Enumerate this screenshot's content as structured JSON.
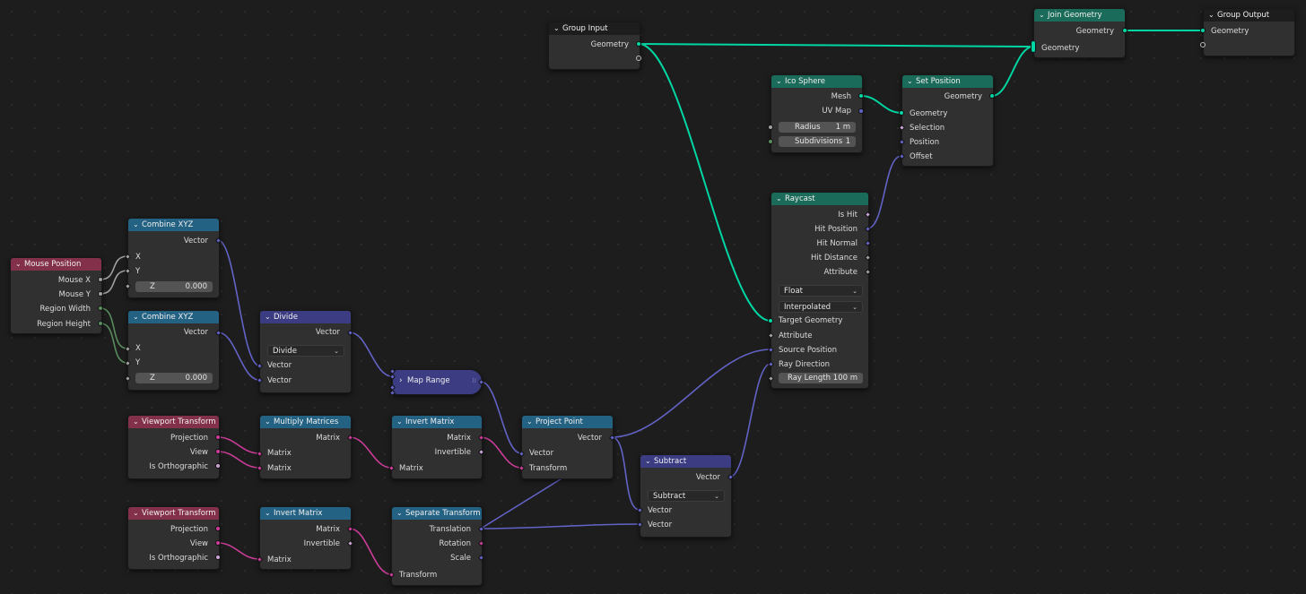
{
  "colors": {
    "geometry": "#00d6a3",
    "vector": "#6363c7",
    "float": "#a1a1a1",
    "int": "#598c5c",
    "bool": "#cca6d6",
    "matrix": "#cc3d99",
    "hdr_geometry": "#1b6b5a",
    "hdr_converter": "#246283",
    "hdr_input": "#83314a",
    "hdr_math": "#3c3c83",
    "hdr_group": "#1d1d1d"
  },
  "nodes": {
    "group_input": {
      "title": "Group Input",
      "geometry": "Geometry"
    },
    "join_geometry": {
      "title": "Join Geometry",
      "geometry_out": "Geometry",
      "geometry_in": "Geometry"
    },
    "group_output": {
      "title": "Group Output",
      "geometry": "Geometry"
    },
    "ico_sphere": {
      "title": "Ico Sphere",
      "mesh": "Mesh",
      "uv_map": "UV Map",
      "radius_label": "Radius",
      "radius_value": "1 m",
      "subdiv_label": "Subdivisions",
      "subdiv_value": "1"
    },
    "set_position": {
      "title": "Set Position",
      "geometry_out": "Geometry",
      "geometry_in": "Geometry",
      "selection": "Selection",
      "position": "Position",
      "offset": "Offset"
    },
    "raycast": {
      "title": "Raycast",
      "is_hit": "Is Hit",
      "hit_position": "Hit Position",
      "hit_normal": "Hit Normal",
      "hit_distance": "Hit Distance",
      "attribute_out": "Attribute",
      "data_type": "Float",
      "mapping": "Interpolated",
      "target_geometry": "Target Geometry",
      "attribute_in": "Attribute",
      "source_position": "Source Position",
      "ray_direction": "Ray Direction",
      "ray_length_label": "Ray Length",
      "ray_length_value": "100 m"
    },
    "mouse_position": {
      "title": "Mouse Position",
      "mouse_x": "Mouse X",
      "mouse_y": "Mouse Y",
      "region_width": "Region Width",
      "region_height": "Region Height"
    },
    "combine_xyz_1": {
      "title": "Combine XYZ",
      "vector": "Vector",
      "x": "X",
      "y": "Y",
      "z_label": "Z",
      "z_value": "0.000"
    },
    "combine_xyz_2": {
      "title": "Combine XYZ",
      "vector": "Vector",
      "x": "X",
      "y": "Y",
      "z_label": "Z",
      "z_value": "0.000"
    },
    "divide": {
      "title": "Divide",
      "vector_out": "Vector",
      "operation": "Divide",
      "vector_a": "Vector",
      "vector_b": "Vector"
    },
    "map_range": {
      "title": "Map Range"
    },
    "viewport_transform_1": {
      "title": "Viewport Transform",
      "projection": "Projection",
      "view": "View",
      "is_ortho": "Is Orthographic"
    },
    "multiply_matrices": {
      "title": "Multiply Matrices",
      "matrix_out": "Matrix",
      "matrix_a": "Matrix",
      "matrix_b": "Matrix"
    },
    "invert_matrix_1": {
      "title": "Invert Matrix",
      "matrix_out": "Matrix",
      "invertible": "Invertible",
      "matrix_in": "Matrix"
    },
    "project_point": {
      "title": "Project Point",
      "vector_out": "Vector",
      "vector_in": "Vector",
      "transform": "Transform"
    },
    "subtract": {
      "title": "Subtract",
      "vector_out": "Vector",
      "operation": "Subtract",
      "vector_a": "Vector",
      "vector_b": "Vector"
    },
    "viewport_transform_2": {
      "title": "Viewport Transform",
      "projection": "Projection",
      "view": "View",
      "is_ortho": "Is Orthographic"
    },
    "invert_matrix_2": {
      "title": "Invert Matrix",
      "matrix_out": "Matrix",
      "invertible": "Invertible",
      "matrix_in": "Matrix"
    },
    "separate_transform": {
      "title": "Separate Transform",
      "translation": "Translation",
      "rotation": "Rotation",
      "scale": "Scale",
      "transform": "Transform"
    }
  }
}
